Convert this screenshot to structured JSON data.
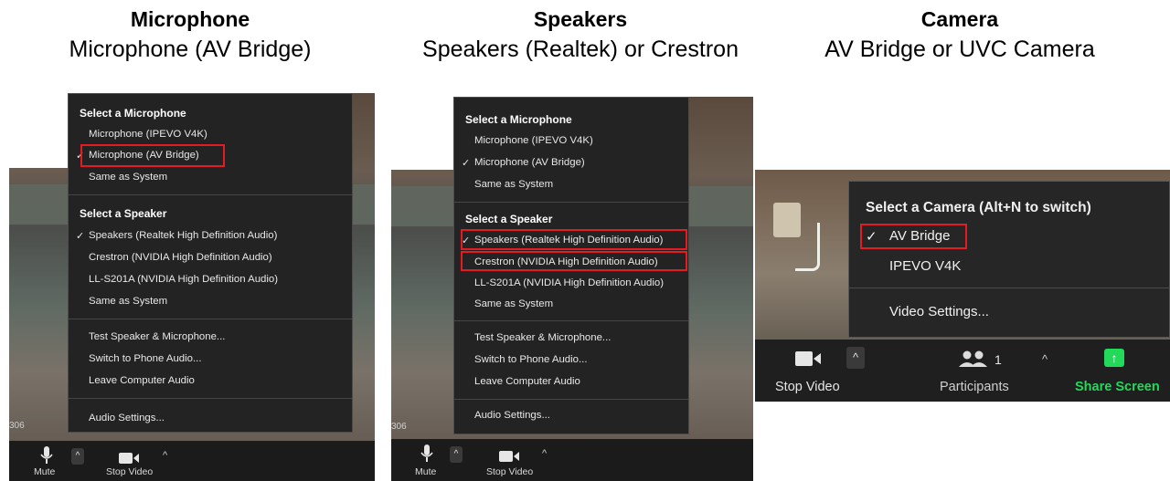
{
  "columns": [
    {
      "title": "Microphone",
      "subtitle": "Microphone (AV Bridge)"
    },
    {
      "title": "Speakers",
      "subtitle": "Speakers (Realtek) or Crestron"
    },
    {
      "title": "Camera",
      "subtitle": "AV Bridge or UVC Camera"
    }
  ],
  "audio_menu": {
    "mic_section": "Select a Microphone",
    "mic_items": [
      "Microphone (IPEVO V4K)",
      "Microphone (AV Bridge)",
      "Same as System"
    ],
    "speaker_section": "Select a Speaker",
    "speaker_items": [
      "Speakers (Realtek High Definition Audio)",
      "Crestron (NVIDIA High Definition Audio)",
      "LL-S201A (NVIDIA High Definition Audio)",
      "Same as System"
    ],
    "actions": [
      "Test Speaker & Microphone...",
      "Switch to Phone Audio...",
      "Leave Computer Audio"
    ],
    "settings": "Audio Settings...",
    "check": "✓"
  },
  "audio_toolbar": {
    "mute": "Mute",
    "stop_video": "Stop Video",
    "room": "306",
    "caret": "^"
  },
  "camera_menu": {
    "title": "Select a Camera (Alt+N to switch)",
    "items": [
      "AV Bridge",
      "IPEVO V4K"
    ],
    "settings": "Video Settings...",
    "check": "✓"
  },
  "camera_toolbar": {
    "stop_video": "Stop Video",
    "participants": "Participants",
    "participants_count": "1",
    "share_screen": "Share Screen",
    "caret": "^"
  },
  "colors": {
    "highlight": "#e41b23",
    "share_green": "#23d959",
    "menu_bg": "#232323"
  }
}
